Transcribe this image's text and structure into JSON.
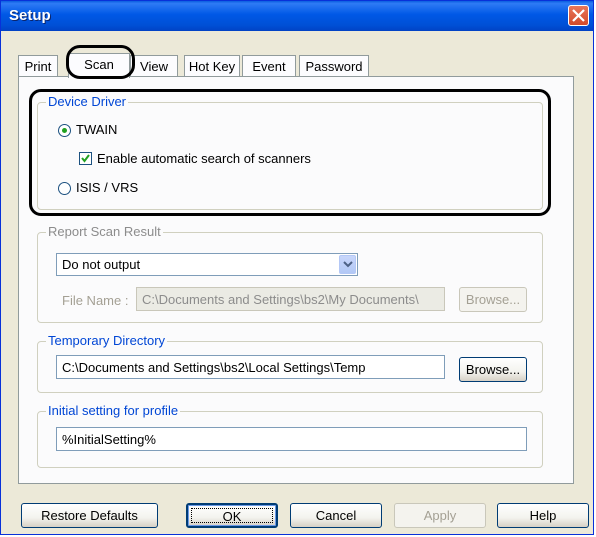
{
  "window": {
    "title": "Setup"
  },
  "tabs": [
    {
      "label": "Print"
    },
    {
      "label": "Scan"
    },
    {
      "label": "View"
    },
    {
      "label": "Hot Key"
    },
    {
      "label": "Event"
    },
    {
      "label": "Password"
    }
  ],
  "active_tab": "Scan",
  "device_driver": {
    "group_label": "Device Driver",
    "twain_label": "TWAIN",
    "twain_selected": true,
    "auto_search_label": "Enable automatic search of scanners",
    "auto_search_checked": true,
    "isis_label": "ISIS / VRS",
    "isis_selected": false
  },
  "report_scan_result": {
    "group_label": "Report Scan Result",
    "output_value": "Do not output",
    "file_name_label": "File Name :",
    "file_name_value": "C:\\Documents and Settings\\bs2\\My Documents\\",
    "browse_label": "Browse..."
  },
  "temporary_directory": {
    "group_label": "Temporary Directory",
    "path_value": "C:\\Documents and Settings\\bs2\\Local Settings\\Temp",
    "browse_label": "Browse..."
  },
  "initial_setting": {
    "group_label": "Initial setting for profile",
    "value": "%InitialSetting%"
  },
  "footer": {
    "restore_defaults": "Restore Defaults",
    "ok": "OK",
    "cancel": "Cancel",
    "apply": "Apply",
    "help": "Help"
  },
  "colors": {
    "titlebar": "#0058e6",
    "group_label": "#0046d5",
    "radio_dot": "#21a121",
    "close_button": "#d34a2a"
  }
}
